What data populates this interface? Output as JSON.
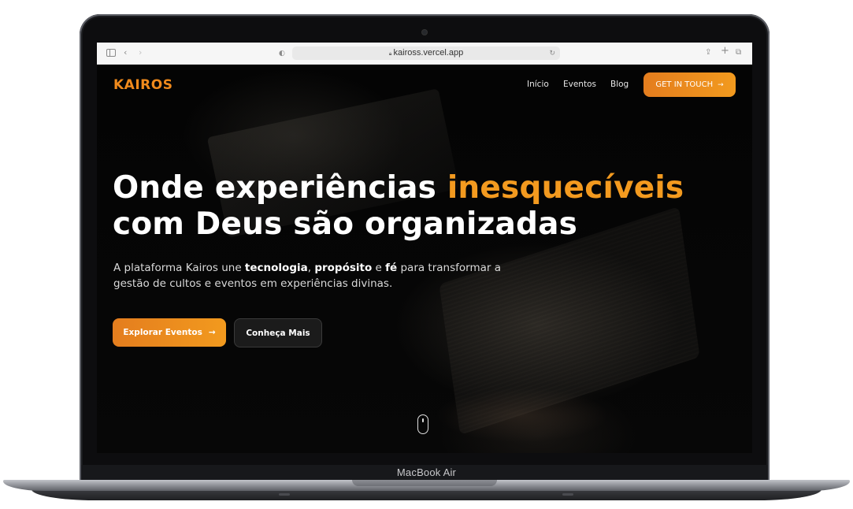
{
  "device": {
    "label": "MacBook Air"
  },
  "browser": {
    "url": "kaiross.vercel.app",
    "icons": [
      "sidebar-icon",
      "back-icon",
      "forward-icon",
      "shield-icon",
      "lock-icon",
      "reload-icon",
      "share-icon",
      "new-tab-icon",
      "tabs-icon"
    ]
  },
  "site": {
    "logo": "KAIROS",
    "nav": [
      {
        "label": "Início"
      },
      {
        "label": "Eventos"
      },
      {
        "label": "Blog"
      }
    ],
    "cta_label": "GET IN TOUCH",
    "headline": {
      "line1_start": "Onde experiências ",
      "line1_accent": "inesquecíveis",
      "line2": "com Deus são organizadas"
    },
    "subtitle": {
      "p1": "A plataforma Kairos une ",
      "b1": "tecnologia",
      "p2": ", ",
      "b2": "propósito",
      "p3": " e ",
      "b3": "fé",
      "p4": " para transformar a gestão de cultos e eventos em experiências divinas."
    },
    "primary_button": "Explorar Eventos",
    "secondary_button": "Conheça Mais",
    "colors": {
      "accent": "#f08a1c",
      "background": "#050505"
    }
  }
}
